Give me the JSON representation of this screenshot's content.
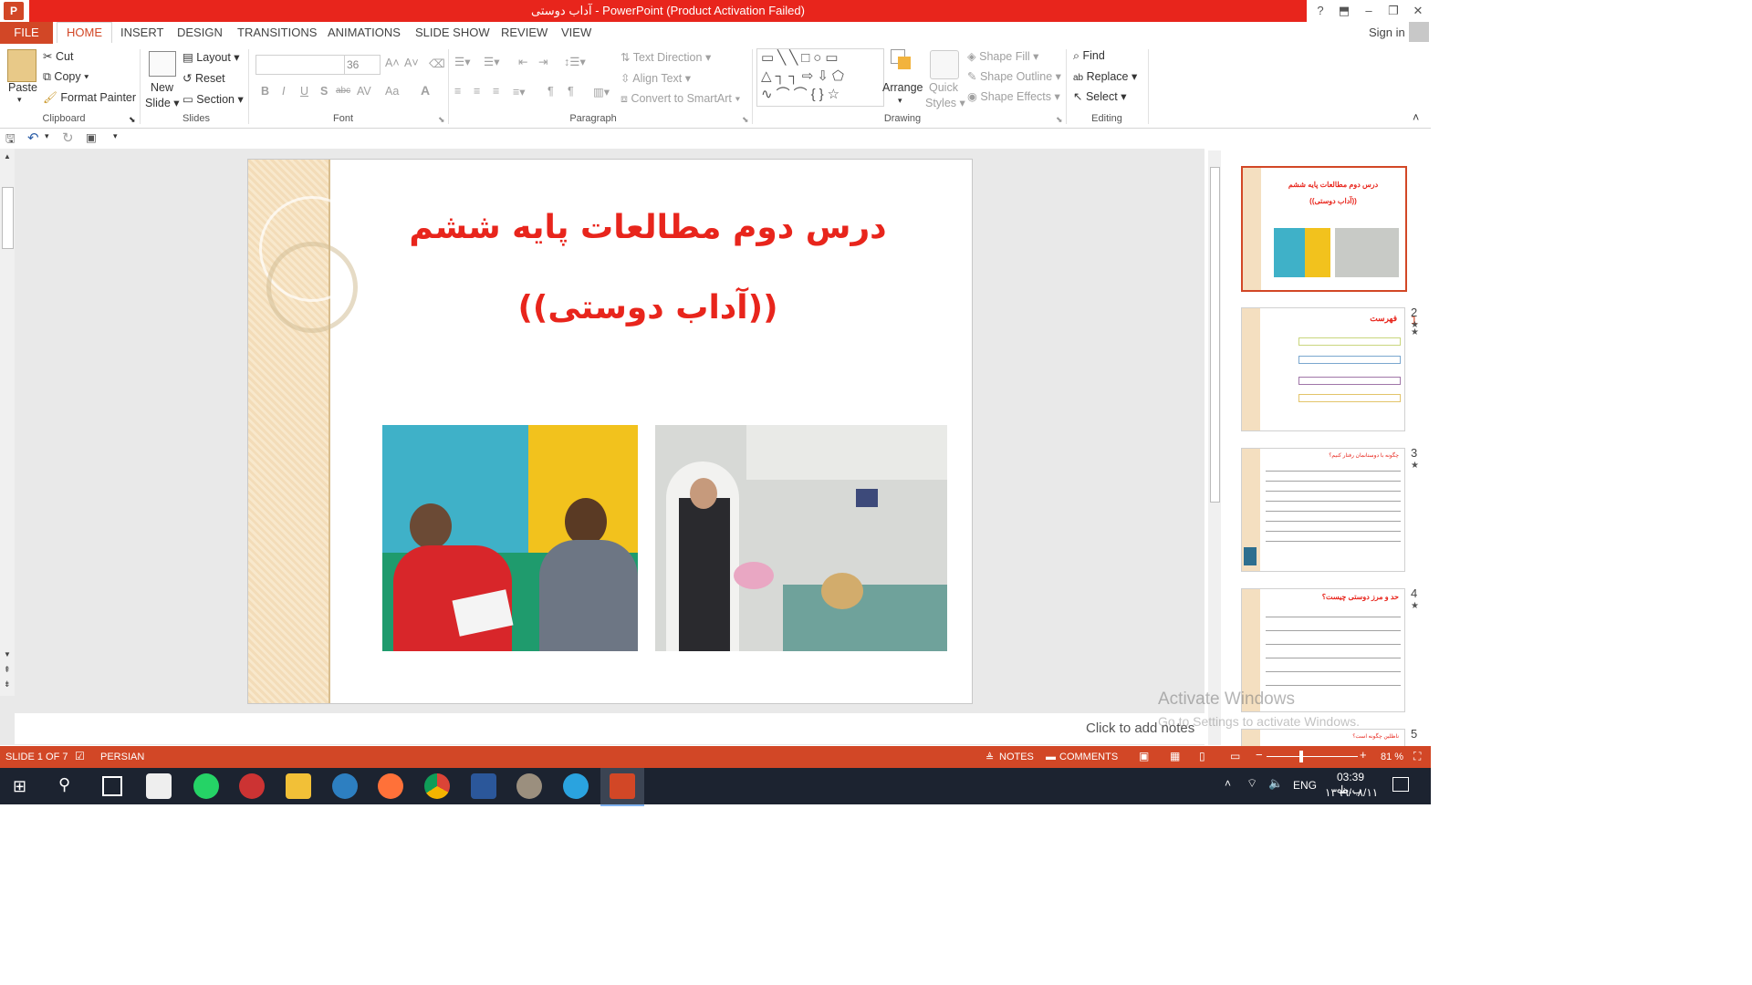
{
  "window": {
    "title": "آداب دوستی - PowerPoint (Product Activation Failed)",
    "app_logo": "P"
  },
  "tabs": {
    "file": "FILE",
    "items": [
      "HOME",
      "INSERT",
      "DESIGN",
      "TRANSITIONS",
      "ANIMATIONS",
      "SLIDE SHOW",
      "REVIEW",
      "VIEW"
    ],
    "sign_in": "Sign in"
  },
  "ribbon": {
    "clipboard": {
      "paste": "Paste",
      "cut": "Cut",
      "copy": "Copy",
      "format_painter": "Format Painter",
      "label": "Clipboard"
    },
    "slides": {
      "new_slide_1": "New",
      "new_slide_2": "Slide",
      "layout": "Layout",
      "reset": "Reset",
      "section": "Section",
      "label": "Slides"
    },
    "font": {
      "font_size": "36",
      "label": "Font",
      "bold": "B",
      "italic": "I",
      "underline": "U",
      "shadow": "S",
      "strike": "abc",
      "spacing": "AV",
      "case": "Aa",
      "color": "A"
    },
    "paragraph": {
      "text_direction": "Text Direction",
      "align_text": "Align Text",
      "convert_smartart": "Convert to SmartArt",
      "label": "Paragraph"
    },
    "drawing": {
      "arrange": "Arrange",
      "quick_styles_1": "Quick",
      "quick_styles_2": "Styles",
      "shape_fill": "Shape Fill",
      "shape_outline": "Shape Outline",
      "shape_effects": "Shape Effects",
      "label": "Drawing"
    },
    "editing": {
      "find": "Find",
      "replace": "Replace",
      "select": "Select",
      "label": "Editing"
    }
  },
  "slide": {
    "title_line1": "درس دوم مطالعات پایه ششم",
    "title_line2": "((آداب دوستی))"
  },
  "notes_placeholder": "Click to add notes",
  "watermark": {
    "line1": "Activate Windows",
    "line2": "Go to Settings to activate Windows."
  },
  "thumbnails": [
    {
      "num": "1",
      "title": "درس دوم مطالعات پایه ششم",
      "subtitle": "((آداب دوستی))"
    },
    {
      "num": "2",
      "title": "فهرست"
    },
    {
      "num": "3",
      "title": "چگونه با دوستانمان رفتار کنیم؟"
    },
    {
      "num": "4",
      "title": "حد و مرز دوستی چیست؟"
    },
    {
      "num": "5",
      "title": "ناظلین چگونه است؟"
    }
  ],
  "status": {
    "slide_of": "SLIDE 1 OF 7",
    "language": "PERSIAN",
    "notes": "NOTES",
    "comments": "COMMENTS",
    "zoom": "81 %"
  },
  "taskbar": {
    "lang": "ENG",
    "time": "03:39 ب.ظ",
    "date": "۱۳۹۹/۰۸/۱۱"
  },
  "colors": {
    "accent": "#d24726",
    "title_red": "#e8251c"
  }
}
